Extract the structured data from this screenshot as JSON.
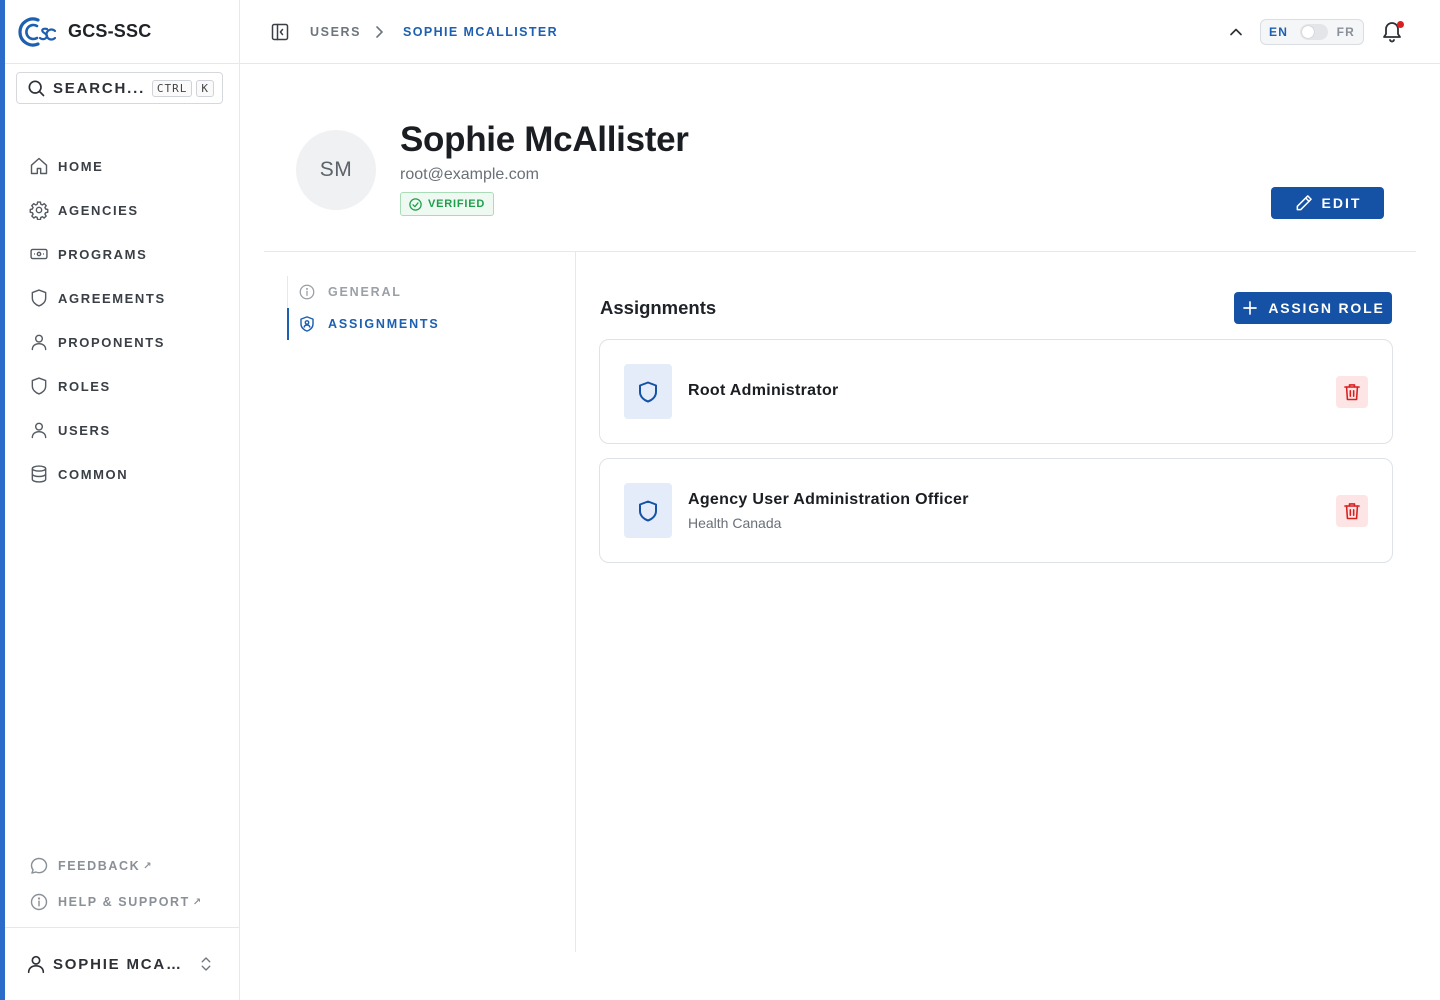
{
  "app": {
    "name": "GCS-SSC"
  },
  "search": {
    "label": "SEARCH...",
    "kbd_mod": "CTRL",
    "kbd_key": "K"
  },
  "nav": {
    "items": [
      {
        "label": "HOME",
        "icon": "home-icon"
      },
      {
        "label": "AGENCIES",
        "icon": "gear-icon"
      },
      {
        "label": "PROGRAMS",
        "icon": "ticket-icon"
      },
      {
        "label": "AGREEMENTS",
        "icon": "shield-icon"
      },
      {
        "label": "PROPONENTS",
        "icon": "user-icon"
      },
      {
        "label": "ROLES",
        "icon": "shield-icon"
      },
      {
        "label": "USERS",
        "icon": "user-icon"
      },
      {
        "label": "COMMON",
        "icon": "database-icon"
      }
    ]
  },
  "sidebar_footer": {
    "feedback": "FEEDBACK",
    "help": "HELP & SUPPORT",
    "external_glyph": "↗",
    "current_user": "SOPHIE MCALLISTER"
  },
  "breadcrumb": {
    "parent": "USERS",
    "current": "SOPHIE MCALLISTER"
  },
  "language": {
    "en": "EN",
    "fr": "FR",
    "active": "EN"
  },
  "profile": {
    "initials": "SM",
    "name": "Sophie McAllister",
    "email": "root@example.com",
    "status": "VERIFIED",
    "edit_label": "EDIT"
  },
  "subnav": {
    "general": "GENERAL",
    "assignments": "ASSIGNMENTS",
    "active": "ASSIGNMENTS"
  },
  "assignments": {
    "title": "Assignments",
    "assign_label": "ASSIGN ROLE",
    "roles": [
      {
        "name": "Root Administrator",
        "agency": ""
      },
      {
        "name": "Agency User Administration Officer",
        "agency": "Health Canada"
      }
    ]
  },
  "colors": {
    "primary": "#1552a6",
    "link": "#1d5fb0",
    "accent_bar": "#2a6cc7",
    "success": "#1e9e4a",
    "danger": "#d92020"
  }
}
